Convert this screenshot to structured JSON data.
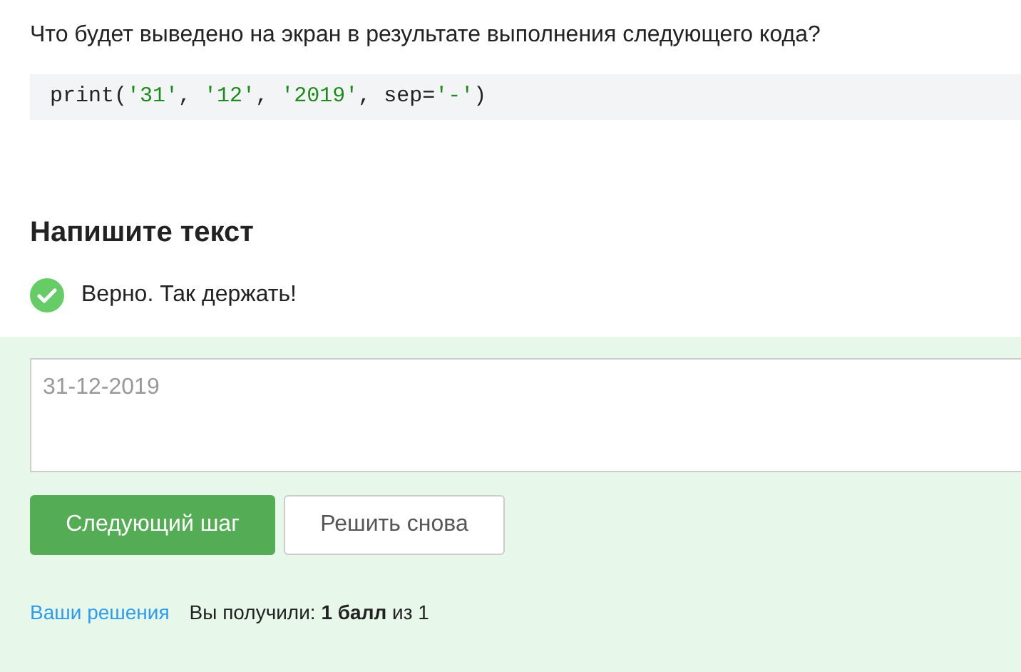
{
  "question": "Что будет выведено на экран в результате выполнения следующего кода?",
  "code": [
    {
      "kind": "plain",
      "text": "print("
    },
    {
      "kind": "string",
      "text": "'31'"
    },
    {
      "kind": "plain",
      "text": ", "
    },
    {
      "kind": "string",
      "text": "'12'"
    },
    {
      "kind": "plain",
      "text": ", "
    },
    {
      "kind": "string",
      "text": "'2019'"
    },
    {
      "kind": "plain",
      "text": ", sep="
    },
    {
      "kind": "string",
      "text": "'-'"
    },
    {
      "kind": "plain",
      "text": ")"
    }
  ],
  "heading": "Напишите текст",
  "feedback": {
    "correct": true,
    "text": "Верно. Так держать!"
  },
  "answer": {
    "value": "31-12-2019",
    "disabled": true
  },
  "buttons": [
    {
      "kind": "primary",
      "label": "Следующий шаг"
    },
    {
      "kind": "secondary",
      "label": "Решить снова"
    }
  ],
  "footer": {
    "link": "Ваши решения",
    "score": "Вы получили: **1 балл** из 1"
  }
}
